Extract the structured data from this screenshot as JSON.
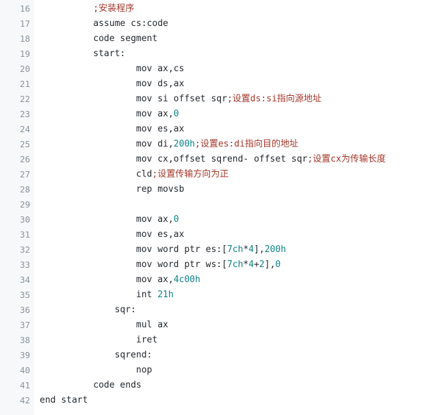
{
  "colors": {
    "gutter_bg": "#f6f8fa",
    "code_bg": "#ffffff",
    "line_number": "#8b949e",
    "text": "#24292f",
    "number": "#0b8486",
    "comment": "#a5372a"
  },
  "lines": [
    {
      "number": "16",
      "indent": "          ",
      "segments": [
        {
          "type": "comment",
          "text": ";安装程序"
        }
      ]
    },
    {
      "number": "17",
      "indent": "          ",
      "segments": [
        {
          "type": "plain",
          "text": "assume cs:code"
        }
      ]
    },
    {
      "number": "18",
      "indent": "          ",
      "segments": [
        {
          "type": "plain",
          "text": "code segment"
        }
      ]
    },
    {
      "number": "19",
      "indent": "          ",
      "segments": [
        {
          "type": "plain",
          "text": "start:"
        }
      ]
    },
    {
      "number": "20",
      "indent": "                  ",
      "segments": [
        {
          "type": "plain",
          "text": "mov ax,cs"
        }
      ]
    },
    {
      "number": "21",
      "indent": "                  ",
      "segments": [
        {
          "type": "plain",
          "text": "mov ds,ax"
        }
      ]
    },
    {
      "number": "22",
      "indent": "                  ",
      "segments": [
        {
          "type": "plain",
          "text": "mov si offset sqr"
        },
        {
          "type": "comment",
          "text": ";设置ds:si指向源地址"
        }
      ]
    },
    {
      "number": "23",
      "indent": "                  ",
      "segments": [
        {
          "type": "plain",
          "text": "mov ax,"
        },
        {
          "type": "number",
          "text": "0"
        }
      ]
    },
    {
      "number": "24",
      "indent": "                  ",
      "segments": [
        {
          "type": "plain",
          "text": "mov es,ax"
        }
      ]
    },
    {
      "number": "25",
      "indent": "                  ",
      "segments": [
        {
          "type": "plain",
          "text": "mov di,"
        },
        {
          "type": "number",
          "text": "200h"
        },
        {
          "type": "comment",
          "text": ";设置es:di指向目的地址"
        }
      ]
    },
    {
      "number": "26",
      "indent": "                  ",
      "segments": [
        {
          "type": "plain",
          "text": "mov cx,offset sqrend- offset sqr"
        },
        {
          "type": "comment",
          "text": ";设置cx为传输长度"
        }
      ]
    },
    {
      "number": "27",
      "indent": "                  ",
      "segments": [
        {
          "type": "plain",
          "text": "cld"
        },
        {
          "type": "comment",
          "text": ";设置传输方向为正"
        }
      ]
    },
    {
      "number": "28",
      "indent": "                  ",
      "segments": [
        {
          "type": "plain",
          "text": "rep movsb"
        }
      ]
    },
    {
      "number": "29",
      "indent": "",
      "segments": []
    },
    {
      "number": "30",
      "indent": "                  ",
      "segments": [
        {
          "type": "plain",
          "text": "mov ax,"
        },
        {
          "type": "number",
          "text": "0"
        }
      ]
    },
    {
      "number": "31",
      "indent": "                  ",
      "segments": [
        {
          "type": "plain",
          "text": "mov es,ax"
        }
      ]
    },
    {
      "number": "32",
      "indent": "                  ",
      "segments": [
        {
          "type": "plain",
          "text": "mov word ptr es:["
        },
        {
          "type": "number",
          "text": "7ch"
        },
        {
          "type": "plain",
          "text": "*"
        },
        {
          "type": "number",
          "text": "4"
        },
        {
          "type": "plain",
          "text": "],"
        },
        {
          "type": "number",
          "text": "200h"
        }
      ]
    },
    {
      "number": "33",
      "indent": "                  ",
      "segments": [
        {
          "type": "plain",
          "text": "mov word ptr ws:["
        },
        {
          "type": "number",
          "text": "7ch"
        },
        {
          "type": "plain",
          "text": "*"
        },
        {
          "type": "number",
          "text": "4"
        },
        {
          "type": "plain",
          "text": "+"
        },
        {
          "type": "number",
          "text": "2"
        },
        {
          "type": "plain",
          "text": "],"
        },
        {
          "type": "number",
          "text": "0"
        }
      ]
    },
    {
      "number": "34",
      "indent": "                  ",
      "segments": [
        {
          "type": "plain",
          "text": "mov ax,"
        },
        {
          "type": "number",
          "text": "4c00h"
        }
      ]
    },
    {
      "number": "35",
      "indent": "                  ",
      "segments": [
        {
          "type": "plain",
          "text": "int "
        },
        {
          "type": "number",
          "text": "21h"
        }
      ]
    },
    {
      "number": "36",
      "indent": "              ",
      "segments": [
        {
          "type": "plain",
          "text": "sqr:"
        }
      ]
    },
    {
      "number": "37",
      "indent": "                  ",
      "segments": [
        {
          "type": "plain",
          "text": "mul ax"
        }
      ]
    },
    {
      "number": "38",
      "indent": "                  ",
      "segments": [
        {
          "type": "plain",
          "text": "iret"
        }
      ]
    },
    {
      "number": "39",
      "indent": "              ",
      "segments": [
        {
          "type": "plain",
          "text": "sqrend:"
        }
      ]
    },
    {
      "number": "40",
      "indent": "                  ",
      "segments": [
        {
          "type": "plain",
          "text": "nop"
        }
      ]
    },
    {
      "number": "41",
      "indent": "          ",
      "segments": [
        {
          "type": "plain",
          "text": "code ends"
        }
      ]
    },
    {
      "number": "42",
      "indent": "",
      "segments": [
        {
          "type": "plain",
          "text": "end start"
        }
      ]
    }
  ]
}
